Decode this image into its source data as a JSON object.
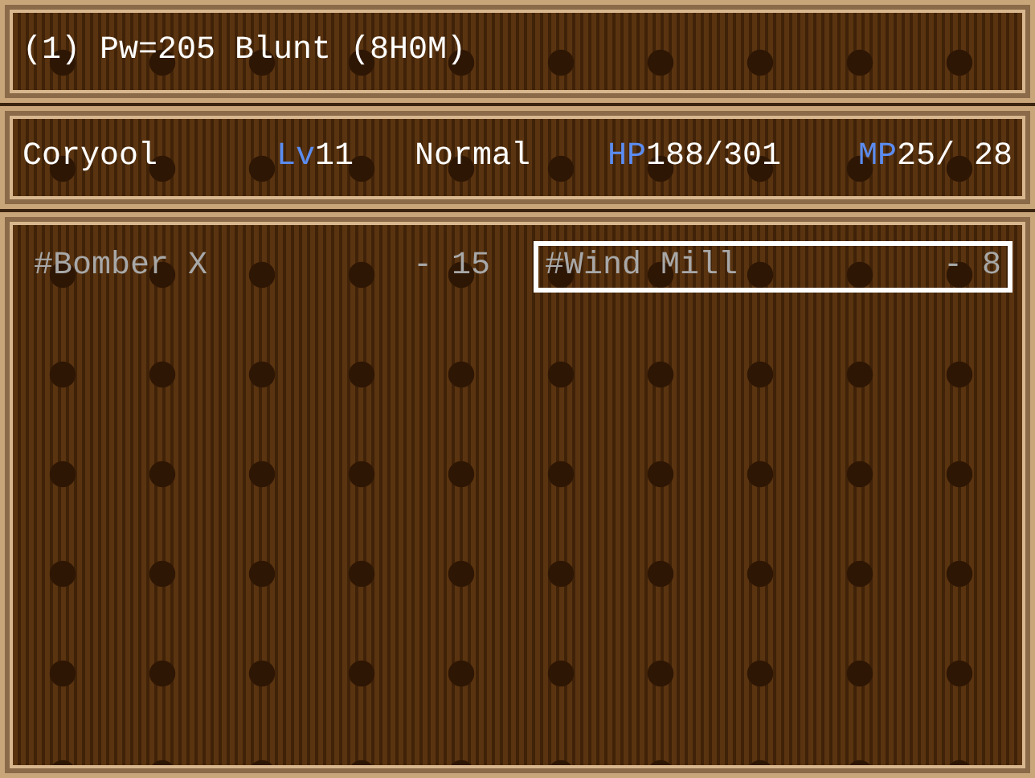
{
  "help": {
    "text": "(1) Pw=205 Blunt (8H0M)"
  },
  "actor": {
    "name": "Coryool",
    "level_label": "Lv",
    "level": "11",
    "state": "Normal",
    "hp_label": "HP",
    "hp": "188/301",
    "mp_label": "MP",
    "mp": "25/ 28"
  },
  "skills": [
    {
      "name": "#Bomber X",
      "cost": "- 15",
      "disabled": true,
      "selected": false
    },
    {
      "name": "#Wind Mill",
      "cost": "- 8",
      "disabled": true,
      "selected": true
    }
  ]
}
